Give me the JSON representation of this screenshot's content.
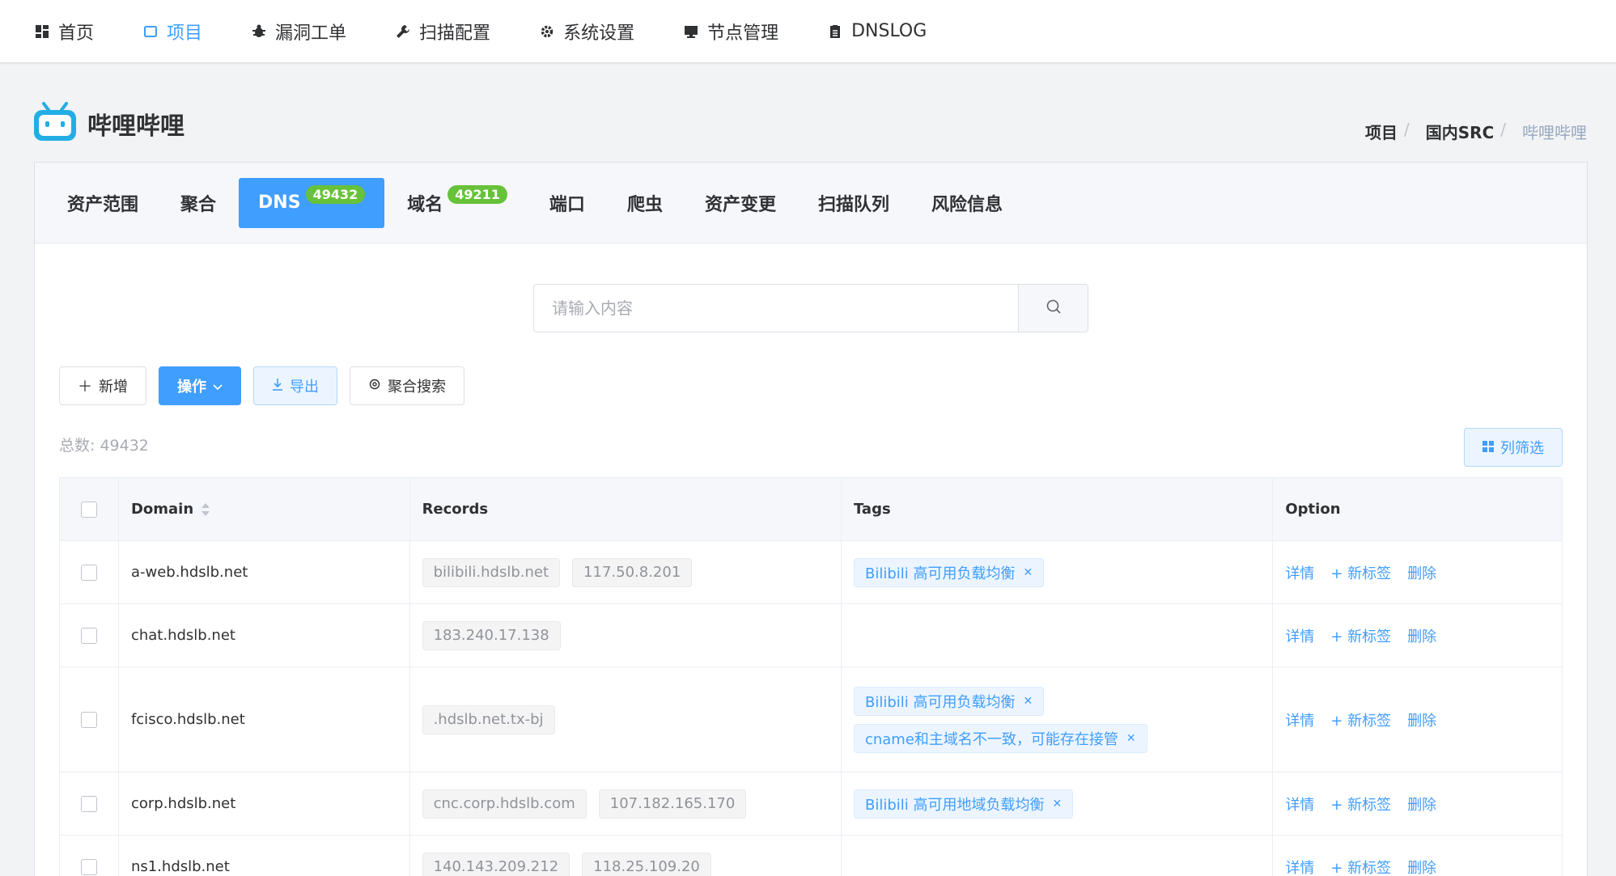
{
  "nav": [
    {
      "label": "首页",
      "icon": "dashboard-icon",
      "active": false
    },
    {
      "label": "项目",
      "icon": "square-icon",
      "active": true
    },
    {
      "label": "漏洞工单",
      "icon": "bug-icon",
      "active": false
    },
    {
      "label": "扫描配置",
      "icon": "wrench-icon",
      "active": false
    },
    {
      "label": "系统设置",
      "icon": "gear-icon",
      "active": false
    },
    {
      "label": "节点管理",
      "icon": "monitor-icon",
      "active": false
    },
    {
      "label": "DNSLOG",
      "icon": "clipboard-icon",
      "active": false
    }
  ],
  "brand": {
    "name": "哔哩哔哩"
  },
  "breadcrumb": [
    "项目",
    "国内SRC",
    "哔哩哔哩"
  ],
  "tabs": [
    {
      "label": "资产范围",
      "badge": null
    },
    {
      "label": "聚合",
      "badge": null
    },
    {
      "label": "DNS",
      "badge": "49432"
    },
    {
      "label": "域名",
      "badge": "49211"
    },
    {
      "label": "端口",
      "badge": null
    },
    {
      "label": "爬虫",
      "badge": null
    },
    {
      "label": "资产变更",
      "badge": null
    },
    {
      "label": "扫描队列",
      "badge": null
    },
    {
      "label": "风险信息",
      "badge": null
    }
  ],
  "search": {
    "placeholder": "请输入内容"
  },
  "toolbar": {
    "add": "新增",
    "ops": "操作",
    "export": "导出",
    "agg_search": "聚合搜索"
  },
  "total_label": "总数: 49432",
  "column_filter": "列筛选",
  "table": {
    "headers": [
      "Domain",
      "Records",
      "Tags",
      "Option"
    ],
    "options": [
      "详情",
      "+ 新标签",
      "删除"
    ],
    "rows": [
      {
        "domain": "a-web.hdslb.net",
        "records": [
          "bilibili.hdslb.net",
          "117.50.8.201"
        ],
        "tags": [
          "Bilibili 高可用负载均衡"
        ]
      },
      {
        "domain": "chat.hdslb.net",
        "records": [
          "183.240.17.138"
        ],
        "tags": []
      },
      {
        "domain": "fcisco.hdslb.net",
        "records": [
          ".hdslb.net.tx-bj"
        ],
        "tags": [
          "Bilibili 高可用负载均衡",
          "cname和主域名不一致，可能存在接管"
        ]
      },
      {
        "domain": "corp.hdslb.net",
        "records": [
          "cnc.corp.hdslb.com",
          "107.182.165.170"
        ],
        "tags": [
          "Bilibili 高可用地域负载均衡"
        ]
      },
      {
        "domain": "ns1.hdslb.net",
        "records": [
          "140.143.209.212",
          "118.25.109.20"
        ],
        "tags": []
      }
    ]
  },
  "colors": {
    "accent": "#409eff",
    "badge": "#67c23a",
    "brand": "#23ade5"
  }
}
